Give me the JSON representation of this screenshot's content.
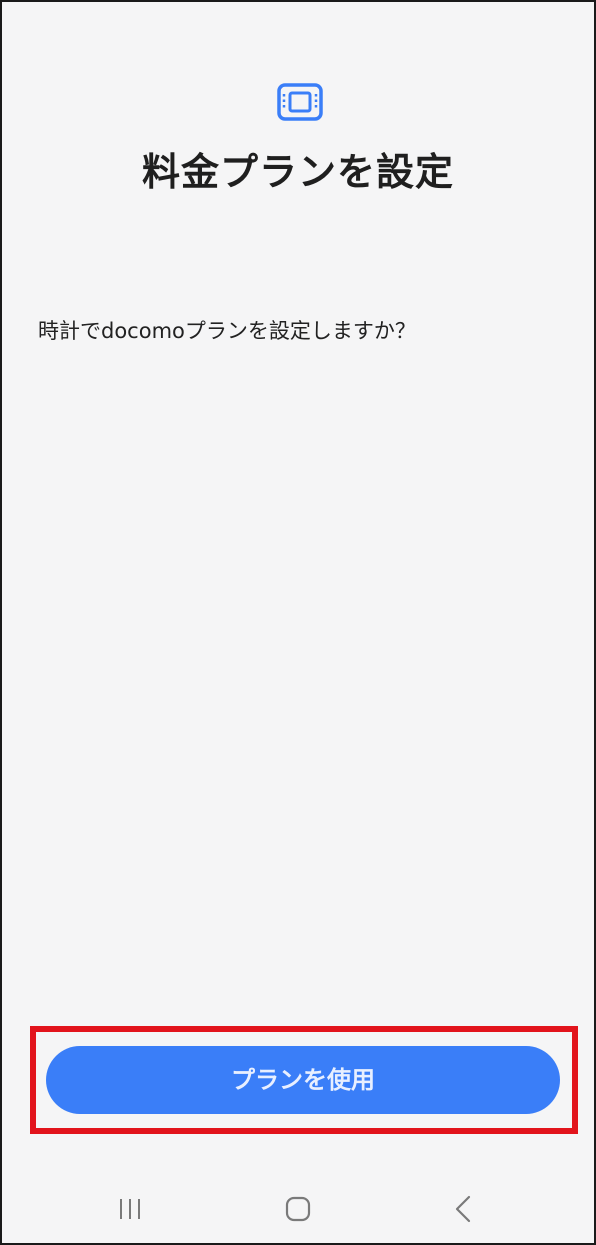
{
  "header": {
    "icon": "plan-card-icon",
    "title": "料金プランを設定"
  },
  "main": {
    "question": "時計でdocomoプランを設定しますか？"
  },
  "actions": {
    "use_plan_label": "プランを使用"
  },
  "navigation": {
    "recents_icon": "recents-icon",
    "home_icon": "home-icon",
    "back_icon": "back-icon"
  },
  "colors": {
    "accent": "#3a7ef8",
    "highlight": "#e2141c",
    "background": "#f5f5f6"
  }
}
